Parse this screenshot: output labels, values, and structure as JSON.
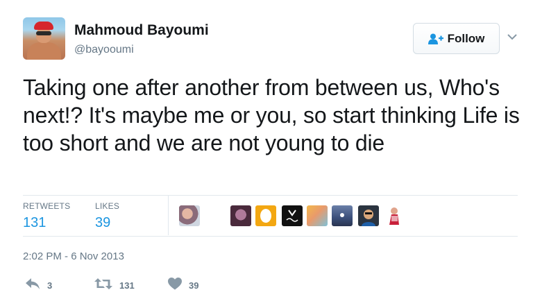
{
  "author": {
    "name": "Mahmoud Bayoumi",
    "handle": "@bayooumi"
  },
  "follow_button": {
    "label": "Follow"
  },
  "tweet": {
    "text": "Taking one after another from between us, Who's next!? It's maybe me or you, so start thinking Life is too short and we are not young to die"
  },
  "stats": {
    "retweets_label": "RETWEETS",
    "retweets_value": "131",
    "likes_label": "LIKES",
    "likes_value": "39"
  },
  "timestamp": "2:02 PM - 6 Nov 2013",
  "actions": {
    "reply_count": "3",
    "retweet_count": "131",
    "like_count": "39"
  },
  "colors": {
    "accent": "#1b95e0",
    "muted": "#657786",
    "text": "#14171a",
    "divider": "#e1e8ed"
  }
}
